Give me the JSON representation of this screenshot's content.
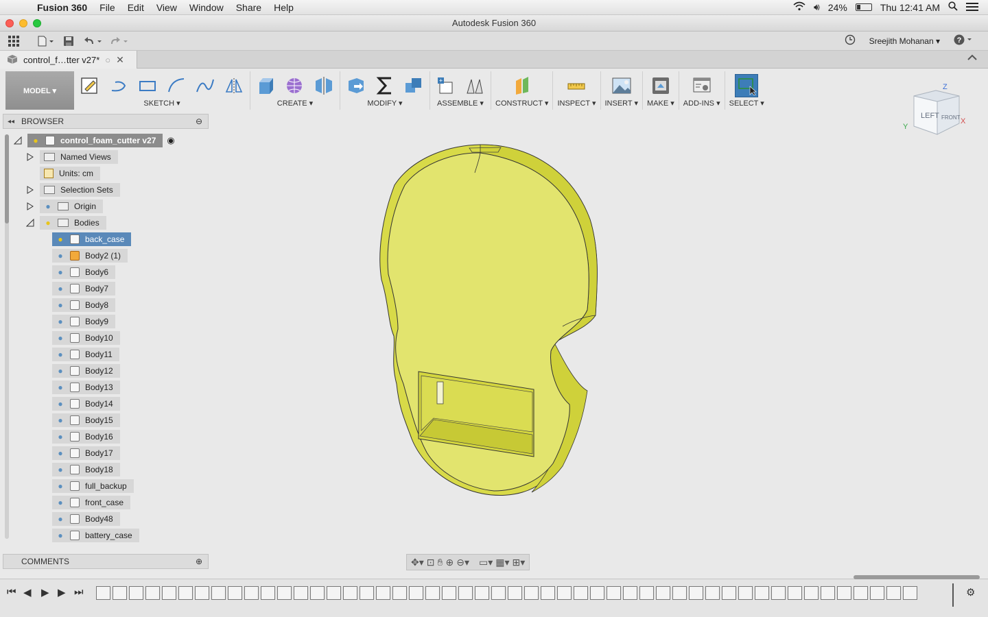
{
  "menubar": {
    "app_name": "Fusion 360",
    "menus": [
      "File",
      "Edit",
      "View",
      "Window",
      "Share",
      "Help"
    ],
    "battery": "24%",
    "clock": "Thu 12:41 AM"
  },
  "window": {
    "title": "Autodesk Fusion 360"
  },
  "toolbar": {
    "user": "Sreejith Mohanan ▾"
  },
  "tab": {
    "doc_name": "control_f…tter v27*"
  },
  "ribbon": {
    "mode": "MODEL ▾",
    "groups": [
      {
        "label": "SKETCH ▾"
      },
      {
        "label": "CREATE ▾"
      },
      {
        "label": "MODIFY ▾"
      },
      {
        "label": "ASSEMBLE ▾"
      },
      {
        "label": "CONSTRUCT ▾"
      },
      {
        "label": "INSPECT ▾"
      },
      {
        "label": "INSERT ▾"
      },
      {
        "label": "MAKE ▾"
      },
      {
        "label": "ADD-INS ▾"
      },
      {
        "label": "SELECT ▾"
      }
    ]
  },
  "browser": {
    "title": "BROWSER",
    "root": "control_foam_cutter v27",
    "named_views": "Named Views",
    "units": "Units: cm",
    "selection_sets": "Selection Sets",
    "origin": "Origin",
    "bodies": "Bodies",
    "body_items": [
      "back_case",
      "Body2 (1)",
      "Body6",
      "Body7",
      "Body8",
      "Body9",
      "Body10",
      "Body11",
      "Body12",
      "Body13",
      "Body14",
      "Body15",
      "Body16",
      "Body17",
      "Body18",
      "full_backup",
      "front_case",
      "Body48",
      "battery_case"
    ]
  },
  "comments": {
    "title": "COMMENTS"
  },
  "viewcube": {
    "left": "LEFT",
    "front": "FRONT",
    "z": "Z",
    "y": "Y",
    "x": "X"
  },
  "colors": {
    "model": "#dfe26a",
    "selected": "#5a89b9",
    "accent": "#3d7db8"
  }
}
